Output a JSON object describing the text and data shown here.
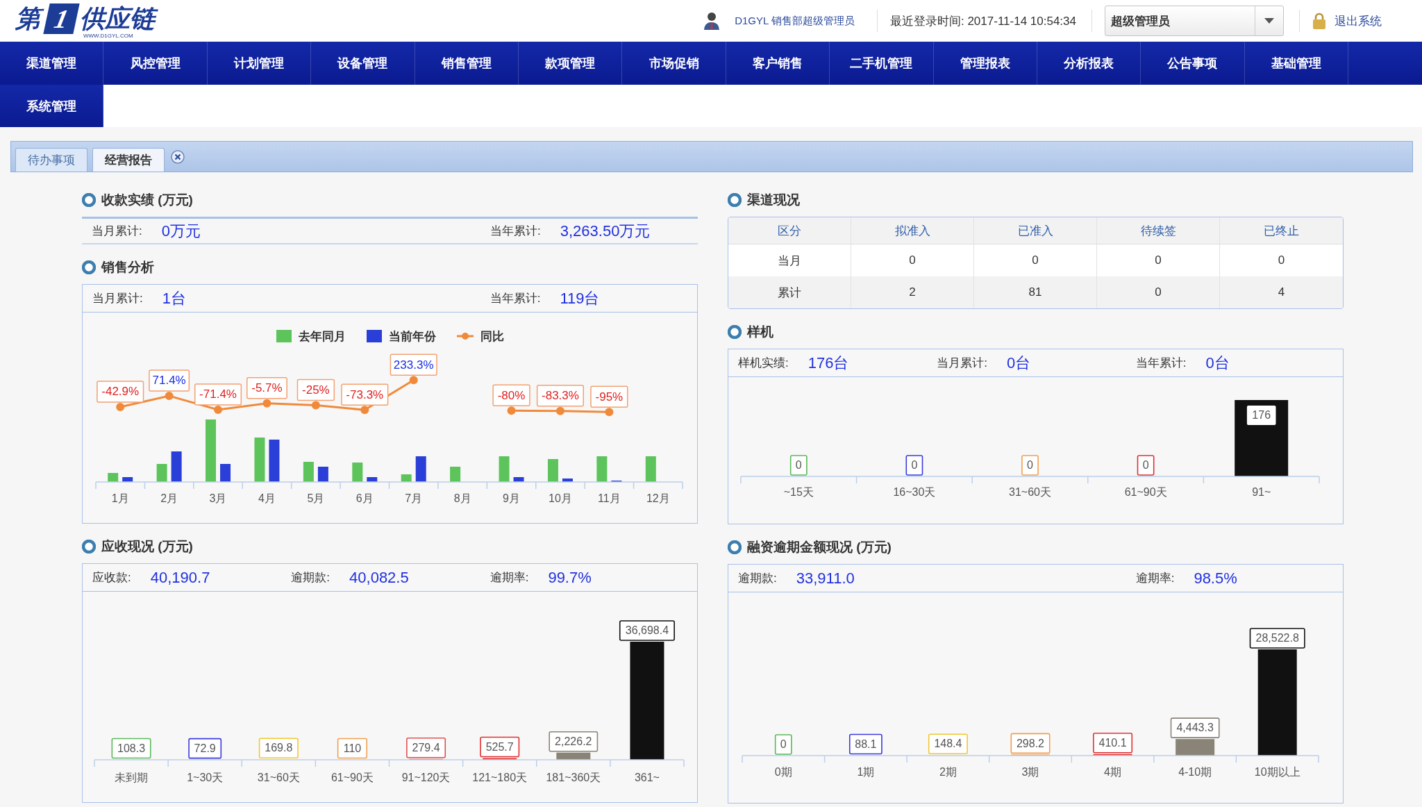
{
  "header": {
    "logo": {
      "first": "第",
      "mark": "1",
      "rest": "供应链",
      "site": "WWW.D1GYL.COM"
    },
    "user": "D1GYL 销售部超级管理员",
    "last_login": "最近登录时间: 2017-11-14 10:54:34",
    "role_select": {
      "value": "超级管理员"
    },
    "logout": "退出系统"
  },
  "nav": [
    "渠道管理",
    "风控管理",
    "计划管理",
    "设备管理",
    "销售管理",
    "款项管理",
    "市场促销",
    "客户销售",
    "二手机管理",
    "管理报表",
    "分析报表",
    "公告事项",
    "基础管理",
    "系统管理"
  ],
  "tabs": [
    {
      "label": "待办事项",
      "selected": false
    },
    {
      "label": "经营报告",
      "selected": true
    }
  ],
  "left": {
    "collection": {
      "title": "收款实绩 (万元)",
      "stats": [
        {
          "label": "当月累计:",
          "value": "0万元"
        },
        {
          "label": "当年累计:",
          "value": "3,263.50万元"
        }
      ]
    },
    "sales": {
      "title": "销售分析",
      "stats": [
        {
          "label": "当月累计:",
          "value": "1台"
        },
        {
          "label": "当年累计:",
          "value": "119台"
        }
      ],
      "legend": [
        {
          "name": "去年同月",
          "kind": "bar",
          "color": "#5cc45a"
        },
        {
          "name": "当前年份",
          "kind": "bar",
          "color": "#2a3ed8"
        },
        {
          "name": "同比",
          "kind": "line",
          "color": "#f08a3a"
        }
      ],
      "chart_data": {
        "type": "line",
        "categories": [
          "1月",
          "2月",
          "3月",
          "4月",
          "5月",
          "6月",
          "7月",
          "8月",
          "9月",
          "10月",
          "11月",
          "12月"
        ],
        "series": [
          {
            "color": "#f08a3a",
            "marker": "circle",
            "values": [
              -42.9,
              71.4,
              -71.4,
              -5.7,
              -25,
              -73.3,
              233.3,
              null,
              -80,
              -83.3,
              -95,
              null
            ],
            "value_labels": [
              "-42.9%",
              "71.4%",
              "-71.4%",
              "-5.7%",
              "-25%",
              "-73.3%",
              "233.3%",
              null,
              "-80%",
              "-83.3%",
              "-95%",
              null
            ]
          }
        ]
      }
    },
    "receivables": {
      "title": "应收现况 (万元)",
      "stats": [
        {
          "label": "应收款:",
          "value": "40,190.7"
        },
        {
          "label": "逾期款:",
          "value": "40,082.5"
        },
        {
          "label": "逾期率:",
          "value": "99.7%"
        }
      ],
      "chart_data": {
        "type": "bar",
        "categories": [
          "未到期",
          "1~30天",
          "31~60天",
          "61~90天",
          "91~120天",
          "121~180天",
          "181~360天",
          "361~"
        ],
        "series": [
          {
            "values": [
              108.3,
              72.9,
              169.8,
              110,
              279.4,
              525.7,
              2226.2,
              36698.4
            ],
            "colors": [
              "#5cb85c",
              "#3a3ae0",
              "#f0c830",
              "#f0a050",
              "#e05050",
              "#e03030",
              "#8a8478",
              "#111111"
            ],
            "value_labels": [
              "108.3",
              "72.9",
              "169.8",
              "110",
              "279.4",
              "525.7",
              "2,226.2",
              "36,698.4"
            ]
          }
        ]
      }
    }
  },
  "right": {
    "channels": {
      "title": "渠道现况",
      "table": {
        "columns": [
          "区分",
          "拟准入",
          "已准入",
          "待续签",
          "已终止"
        ],
        "rows": [
          [
            "当月",
            "0",
            "0",
            "0",
            "0"
          ],
          [
            "累计",
            "2",
            "81",
            "0",
            "4"
          ]
        ]
      }
    },
    "samples": {
      "title": "样机",
      "stats": [
        {
          "label": "样机实绩:",
          "value": "176台"
        },
        {
          "label": "当月累计:",
          "value": "0台"
        },
        {
          "label": "当年累计:",
          "value": "0台"
        }
      ],
      "chart_data": {
        "type": "bar",
        "categories": [
          "~15天",
          "16~30天",
          "31~60天",
          "61~90天",
          "91~"
        ],
        "series": [
          {
            "values": [
              0,
              0,
              0,
              0,
              176
            ],
            "colors": [
              "#5cb85c",
              "#3a3ae0",
              "#f0a050",
              "#e03030",
              "#111111"
            ],
            "value_labels": [
              "0",
              "0",
              "0",
              "0",
              "176"
            ]
          }
        ]
      }
    },
    "financing": {
      "title": "融资逾期金额现况 (万元)",
      "stats": [
        {
          "label": "逾期款:",
          "value": "33,911.0"
        },
        {
          "label": "逾期率:",
          "value": "98.5%"
        }
      ],
      "chart_data": {
        "type": "bar",
        "categories": [
          "0期",
          "1期",
          "2期",
          "3期",
          "4期",
          "4-10期",
          "10期以上"
        ],
        "series": [
          {
            "values": [
              0,
              88.1,
              148.4,
              298.2,
              410.1,
              4443.3,
              28522.8
            ],
            "colors": [
              "#5cb85c",
              "#3a3ae0",
              "#f0c830",
              "#f0a050",
              "#e03030",
              "#8a8478",
              "#111111"
            ],
            "value_labels": [
              "0",
              "88.1",
              "148.4",
              "298.2",
              "410.1",
              "4,443.3",
              "28,522.8"
            ]
          }
        ]
      }
    }
  }
}
